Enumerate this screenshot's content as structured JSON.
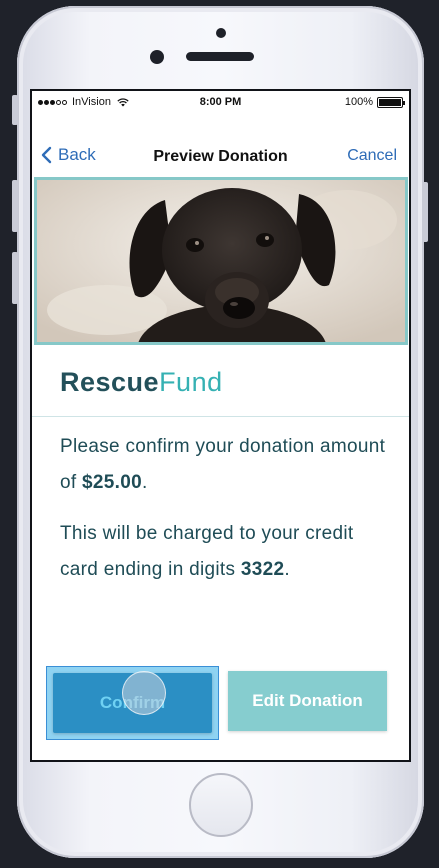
{
  "status_bar": {
    "carrier": "InVision",
    "time": "8:00 PM",
    "battery": "100%"
  },
  "nav": {
    "back_label": "Back",
    "title": "Preview Donation",
    "cancel_label": "Cancel"
  },
  "brand": {
    "part1": "Rescue",
    "part2": "Fund"
  },
  "message": {
    "line1_prefix": "Please confirm your donation amount of ",
    "amount": "$25.00",
    "line1_suffix": ".",
    "line2_prefix": "This will  be charged to  your credit card ending in digits ",
    "digits": "3322",
    "line2_suffix": "."
  },
  "actions": {
    "confirm_label": "Confirm",
    "edit_label": "Edit Donation"
  },
  "colors": {
    "accent_blue": "#2e6cb7",
    "brand_dark": "#23505a",
    "brand_teal": "#35b1b3",
    "confirm_bg": "#2b8fc4",
    "edit_bg": "#86cdcf"
  }
}
